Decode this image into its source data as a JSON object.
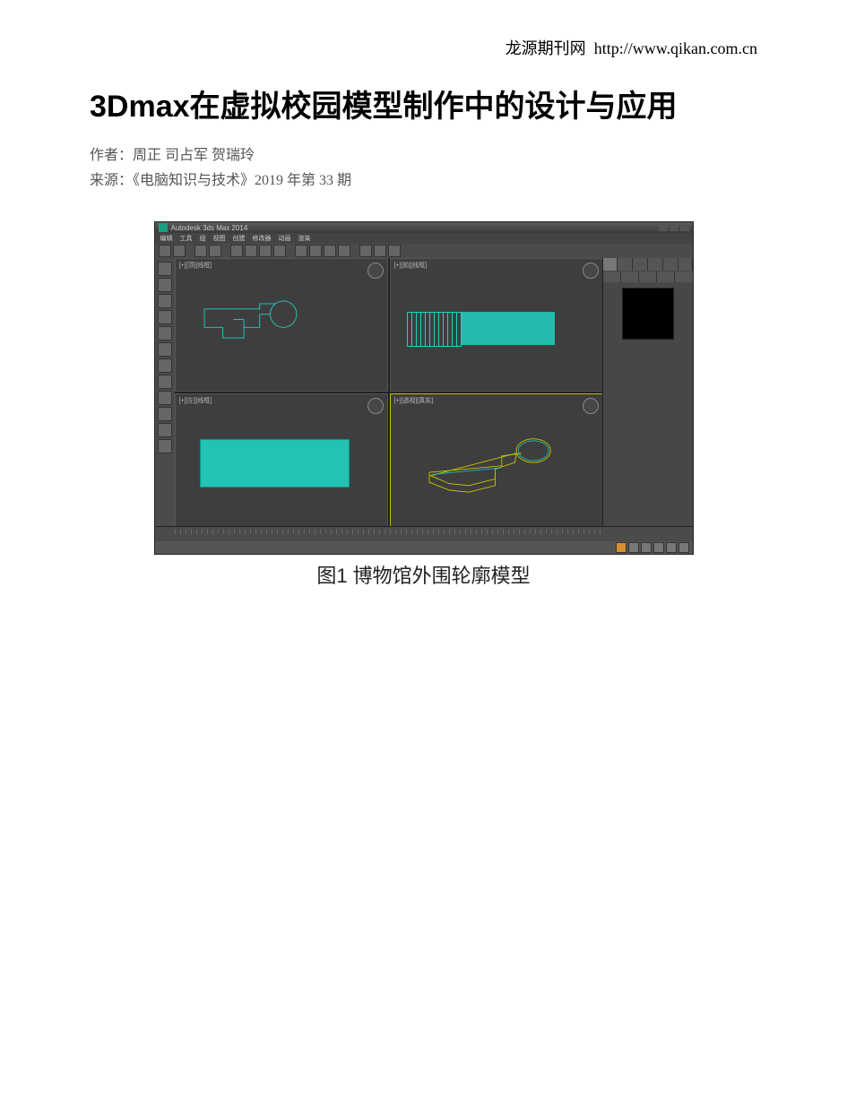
{
  "header": {
    "site_name": "龙源期刊网",
    "url": "http://www.qikan.com.cn"
  },
  "article": {
    "title": "3Dmax在虚拟校园模型制作中的设计与应用",
    "author_label": "作者：",
    "authors": "周正 司占军 贺瑞玲",
    "source_label": "来源：",
    "source": "《电脑知识与技术》2019 年第 33 期"
  },
  "figure": {
    "caption": "图1  博物馆外围轮廓模型",
    "app_title": "Autodesk 3ds Max 2014",
    "viewports": {
      "top": "[+][顶][线框]",
      "front": "[+][前][线框]",
      "left": "[+][左][线框]",
      "perspective": "[+][透视][真实]"
    },
    "colors": {
      "wire": "#1fd1c1",
      "edge": "#c9c900",
      "ui_bg": "#3e3e3e"
    }
  }
}
